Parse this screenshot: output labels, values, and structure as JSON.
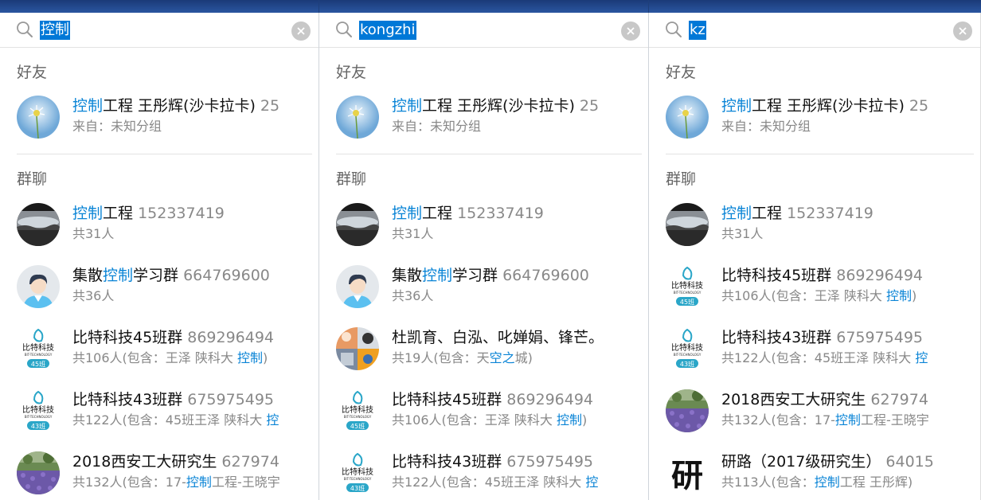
{
  "panels": [
    {
      "query": "控制",
      "friends_label": "好友",
      "groups_label": "群聊",
      "friends": [
        {
          "pre": "",
          "hl": "控制",
          "post": "工程  王彤辉(沙卡拉卡)",
          "num": "25",
          "sub": [
            "来自：未知分组",
            "",
            ""
          ],
          "avatar": "dandelion-photo"
        }
      ],
      "groups": [
        {
          "pre": "",
          "hl": "控制",
          "post": "工程",
          "num": "152337419",
          "sub": [
            "共31人",
            "",
            ""
          ],
          "avatar": "lake-photo"
        },
        {
          "pre": "集散",
          "hl": "控制",
          "post": "学习群",
          "num": "664769600",
          "sub": [
            "共36人",
            "",
            ""
          ],
          "avatar": "default-person"
        },
        {
          "pre": "比特科技45班群",
          "hl": "",
          "post": "",
          "num": "869296494",
          "sub": [
            "共106人(包含：王泽 陕科大 ",
            "控制",
            ")"
          ],
          "avatar": "bitkeji-45"
        },
        {
          "pre": "比特科技43班群",
          "hl": "",
          "post": "",
          "num": "675975495",
          "sub": [
            "共122人(包含：45班王泽 陕科大 ",
            "控",
            ""
          ],
          "avatar": "bitkeji-43"
        },
        {
          "pre": "2018西安工大研究生",
          "hl": "",
          "post": "",
          "num": "627974",
          "sub": [
            "共132人(包含：17-",
            "控制",
            "工程-王晓宇"
          ],
          "avatar": "flower-field"
        }
      ]
    },
    {
      "query": "kongzhi",
      "friends_label": "好友",
      "groups_label": "群聊",
      "friends": [
        {
          "pre": "",
          "hl": "控制",
          "post": "工程  王彤辉(沙卡拉卡)",
          "num": "25",
          "sub": [
            "来自：未知分组",
            "",
            ""
          ],
          "avatar": "dandelion-photo"
        }
      ],
      "groups": [
        {
          "pre": "",
          "hl": "控制",
          "post": "工程",
          "num": "152337419",
          "sub": [
            "共31人",
            "",
            ""
          ],
          "avatar": "lake-photo"
        },
        {
          "pre": "集散",
          "hl": "控制",
          "post": "学习群",
          "num": "664769600",
          "sub": [
            "共36人",
            "",
            ""
          ],
          "avatar": "default-person"
        },
        {
          "pre": "杜凯育、白泓、叱婵娟、锋芒。",
          "hl": "",
          "post": "",
          "num": "",
          "sub": [
            "共19人(包含：天",
            "空之",
            "城)"
          ],
          "avatar": "collage"
        },
        {
          "pre": "比特科技45班群",
          "hl": "",
          "post": "",
          "num": "869296494",
          "sub": [
            "共106人(包含：王泽 陕科大 ",
            "控制",
            ")"
          ],
          "avatar": "bitkeji-45"
        },
        {
          "pre": "比特科技43班群",
          "hl": "",
          "post": "",
          "num": "675975495",
          "sub": [
            "共122人(包含：45班王泽 陕科大 ",
            "控",
            ""
          ],
          "avatar": "bitkeji-43"
        }
      ]
    },
    {
      "query": "kz",
      "friends_label": "好友",
      "groups_label": "群聊",
      "friends": [
        {
          "pre": "",
          "hl": "控制",
          "post": "工程  王彤辉(沙卡拉卡)",
          "num": "25",
          "sub": [
            "来自：未知分组",
            "",
            ""
          ],
          "avatar": "dandelion-photo"
        }
      ],
      "groups": [
        {
          "pre": "",
          "hl": "控制",
          "post": "工程",
          "num": "152337419",
          "sub": [
            "共31人",
            "",
            ""
          ],
          "avatar": "lake-photo"
        },
        {
          "pre": "比特科技45班群",
          "hl": "",
          "post": "",
          "num": "869296494",
          "sub": [
            "共106人(包含：王泽 陕科大 ",
            "控制",
            ")"
          ],
          "avatar": "bitkeji-45"
        },
        {
          "pre": "比特科技43班群",
          "hl": "",
          "post": "",
          "num": "675975495",
          "sub": [
            "共122人(包含：45班王泽 陕科大 ",
            "控",
            ""
          ],
          "avatar": "bitkeji-43"
        },
        {
          "pre": "2018西安工大研究生",
          "hl": "",
          "post": "",
          "num": "627974",
          "sub": [
            "共132人(包含：17-",
            "控制",
            "工程-王晓宇"
          ],
          "avatar": "flower-field"
        },
        {
          "pre": "研路（2017级研究生）",
          "hl": "",
          "post": "",
          "num": "64015",
          "sub": [
            "共113人(包含：",
            "控制",
            "工程  王彤辉)"
          ],
          "avatar": "calligraphy-yan"
        }
      ]
    }
  ],
  "logo_text": {
    "brand": "比特科技",
    "sub": "BIT-TECHNOLOGY",
    "badge45": "45班",
    "badge43": "43班",
    "glyph": "研"
  },
  "colors": {
    "highlight": "#0a84d6",
    "selection": "#0078d7",
    "muted": "#888888"
  }
}
